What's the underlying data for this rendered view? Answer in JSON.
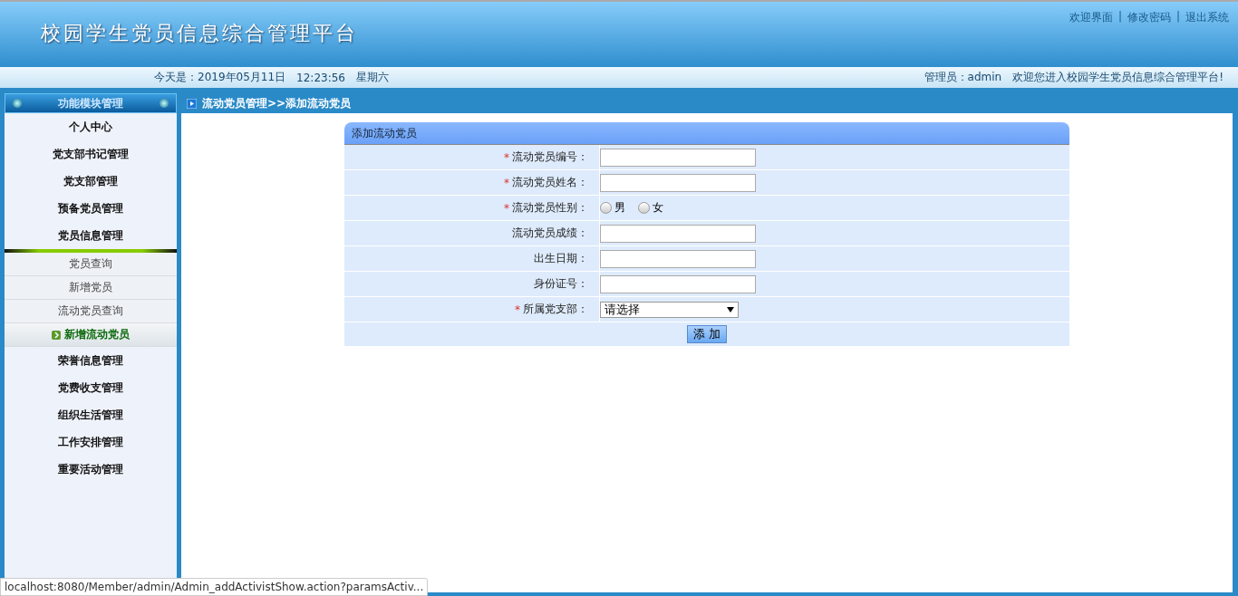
{
  "header": {
    "title": "校园学生党员信息综合管理平台",
    "links": [
      "欢迎界面",
      "修改密码",
      "退出系统"
    ],
    "separator": "|"
  },
  "info_bar": {
    "date": "今天是：2019年05月11日",
    "time": "12:23:56",
    "weekday": "星期六",
    "admin": "管理员：admin",
    "welcome": "欢迎您进入校园学生党员信息综合管理平台!"
  },
  "sidebar": {
    "title": "功能模块管理",
    "items": [
      {
        "label": "个人中心"
      },
      {
        "label": "党支部书记管理"
      },
      {
        "label": "党支部管理"
      },
      {
        "label": "预备党员管理"
      },
      {
        "label": "党员信息管理",
        "expanded": true,
        "children": [
          {
            "label": "党员查询",
            "selected": false
          },
          {
            "label": "新增党员",
            "selected": false
          },
          {
            "label": "流动党员查询",
            "selected": false
          },
          {
            "label": "新增流动党员",
            "selected": true
          }
        ]
      },
      {
        "label": "荣誉信息管理"
      },
      {
        "label": "党费收支管理"
      },
      {
        "label": "组织生活管理"
      },
      {
        "label": "工作安排管理"
      },
      {
        "label": "重要活动管理"
      }
    ]
  },
  "breadcrumb": "流动党员管理>>添加流动党员",
  "form": {
    "title": "添加流动党员",
    "required_mark": "*",
    "fields": [
      {
        "kind": "text",
        "label": "流动党员编号：",
        "required": true
      },
      {
        "kind": "text",
        "label": "流动党员姓名：",
        "required": true
      },
      {
        "kind": "radio",
        "label": "流动党员性别：",
        "required": true,
        "options": [
          {
            "label": "男",
            "selected": false
          },
          {
            "label": "女",
            "selected": false
          }
        ]
      },
      {
        "kind": "text",
        "label": "流动党员成绩：",
        "required": false
      },
      {
        "kind": "text",
        "label": "出生日期：",
        "required": false
      },
      {
        "kind": "text",
        "label": "身份证号：",
        "required": false
      },
      {
        "kind": "select",
        "label": "所属党支部：",
        "required": true,
        "value": "请选择"
      }
    ],
    "submit": "添 加"
  },
  "status_bar": "localhost:8080/Member/admin/Admin_addActivistShow.action?paramsActiv..."
}
